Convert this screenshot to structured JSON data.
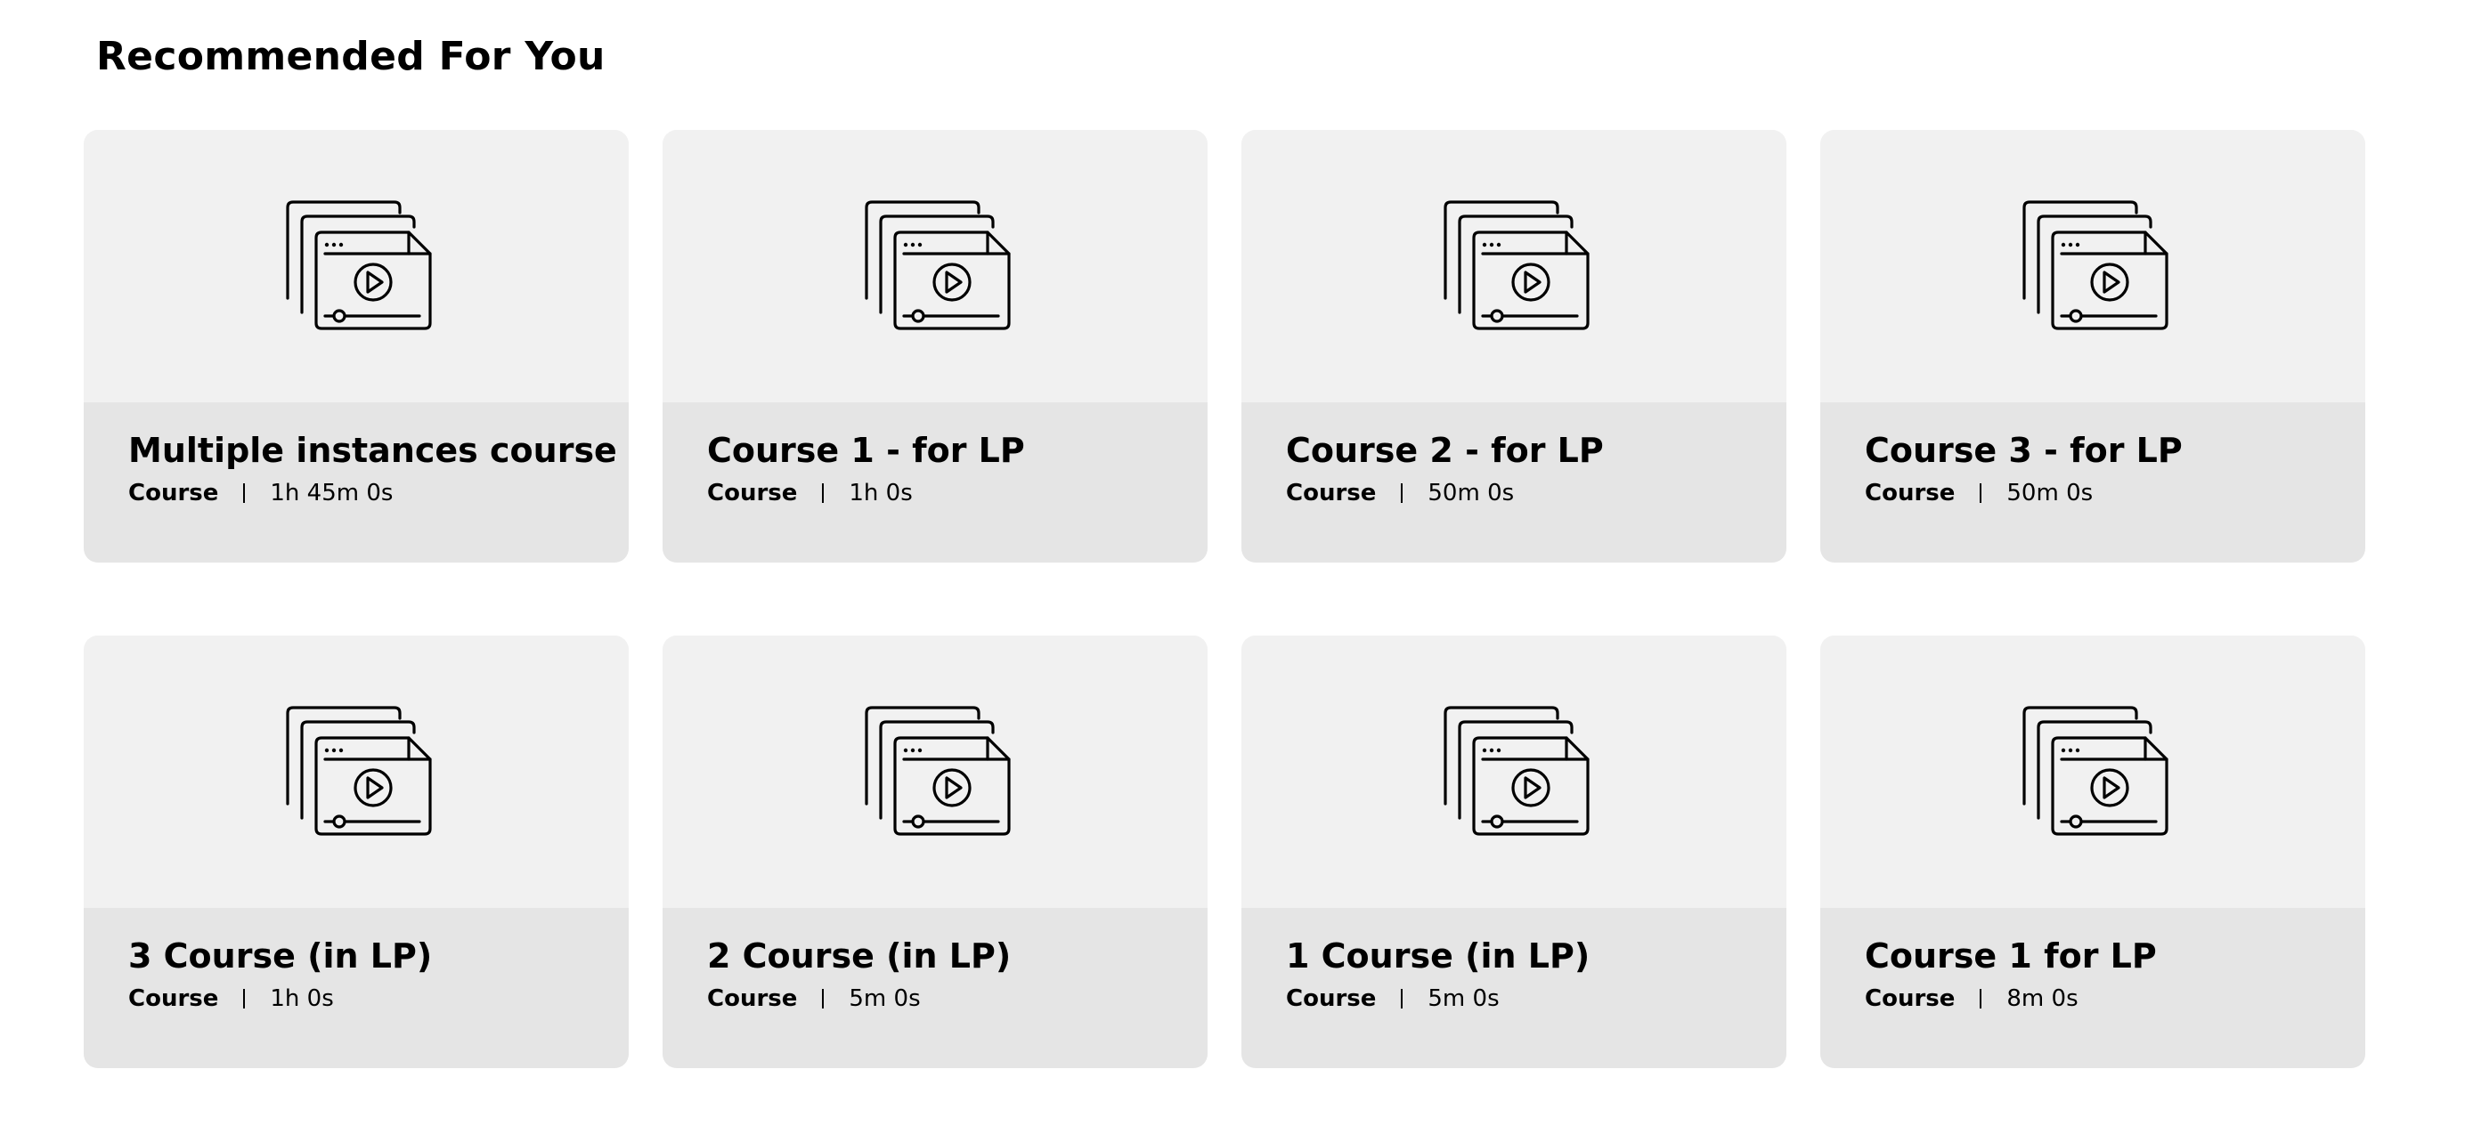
{
  "section": {
    "title": "Recommended For You"
  },
  "cards": [
    {
      "title": "Multiple instances course",
      "type": "Course",
      "duration": "1h 45m 0s",
      "icon": "video-course-icon"
    },
    {
      "title": "Course 1 - for LP",
      "type": "Course",
      "duration": "1h 0s",
      "icon": "video-course-icon"
    },
    {
      "title": "Course 2 - for LP",
      "type": "Course",
      "duration": "50m 0s",
      "icon": "video-course-icon"
    },
    {
      "title": "Course 3 - for LP",
      "type": "Course",
      "duration": "50m 0s",
      "icon": "video-course-icon"
    },
    {
      "title": "3 Course (in LP)",
      "type": "Course",
      "duration": "1h 0s",
      "icon": "video-course-icon"
    },
    {
      "title": "2 Course (in LP)",
      "type": "Course",
      "duration": "5m 0s",
      "icon": "video-course-icon"
    },
    {
      "title": "1 Course (in LP)",
      "type": "Course",
      "duration": "5m 0s",
      "icon": "video-course-icon"
    },
    {
      "title": "Course 1 for LP",
      "type": "Course",
      "duration": "8m 0s",
      "icon": "video-course-icon"
    }
  ],
  "colors": {
    "thumb_bg": "#f1f1f1",
    "info_bg": "#e5e5e5",
    "text": "#000000"
  }
}
